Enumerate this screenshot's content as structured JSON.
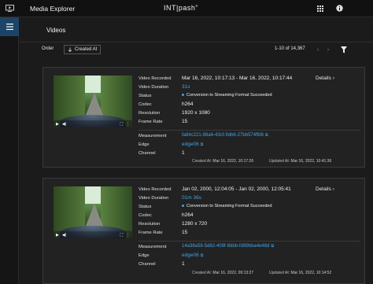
{
  "app": {
    "title": "Media Explorer",
    "brand": "INT|pash",
    "brand_mark": "®",
    "icons": [
      "monitor-icon",
      "grid-icon",
      "info-icon",
      "menu-icon"
    ]
  },
  "page": {
    "title": "Videos"
  },
  "toolbar": {
    "order_label": "Order",
    "order_value": "Created At",
    "paging": "1-10 of 14,367"
  },
  "labels": {
    "video_recorded": "Video Recorded",
    "video_duration": "Video Duration",
    "status": "Status",
    "codec": "Codec",
    "resolution": "Resolution",
    "frame_rate": "Frame Rate",
    "measurement": "Measurement",
    "edge": "Edge",
    "channel": "Channel",
    "details": "Details",
    "created_at": "Created At:",
    "updated_at": "Updated At:"
  },
  "videos": [
    {
      "recorded": "Mar 16, 2022, 10:17:13  -  Mar 16, 2022, 10:17:44",
      "duration": "31s",
      "status": "Conversion to Streaming Format Succeeded",
      "codec": "h264",
      "resolution": "1920 x 1080",
      "frame_rate": "15",
      "measurement": "fa84c221-98a6-43cf-9db6-27bb574ffd6",
      "edge": "edge06",
      "channel": "1",
      "created_at": "Mar 16, 2022, 10:17:26",
      "updated_at": "Mar 16, 2022, 10:41:36"
    },
    {
      "recorded": "Jan 02, 2000, 12:04:05  -  Jan 02, 2000, 12:05:41",
      "duration": "01m 36s",
      "status": "Conversion to Streaming Format Succeeded",
      "codec": "h264",
      "resolution": "1280 x 720",
      "frame_rate": "15",
      "measurement": "14a38a58-5d82-409f-8dbb-fd99bba4e48d",
      "edge": "edge06",
      "channel": "1",
      "created_at": "Mar 16, 2022, 09:13:27",
      "updated_at": "Mar 16, 2022, 10:14:52"
    }
  ],
  "colors": {
    "accent": "#3fa4e8",
    "menu_active": "#1d4466",
    "background": "#1b1b1b",
    "card": "#222222"
  }
}
